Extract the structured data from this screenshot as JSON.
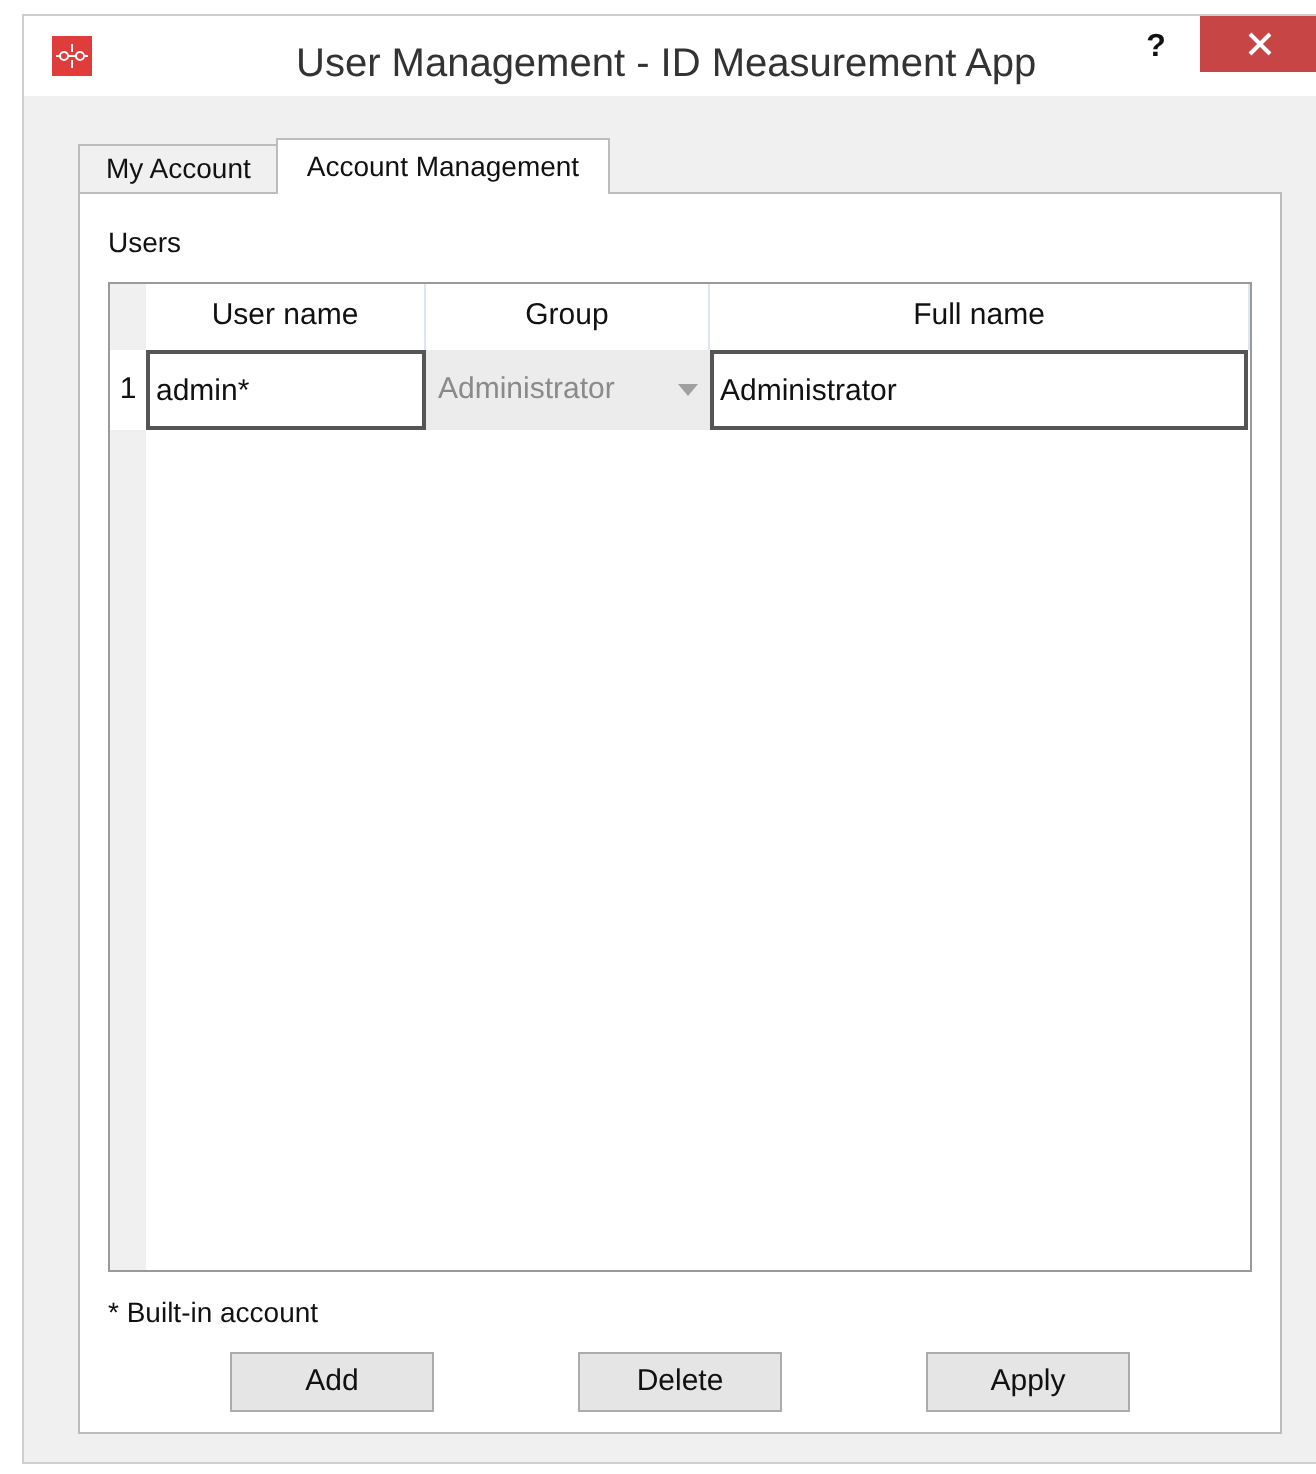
{
  "window": {
    "title": "User Management - ID Measurement App",
    "help": "?"
  },
  "tabs": [
    {
      "label": "My Account",
      "selected": false
    },
    {
      "label": "Account Management",
      "selected": true
    }
  ],
  "users_label": "Users",
  "table": {
    "columns": [
      "User name",
      "Group",
      "Full name"
    ],
    "rows": [
      {
        "number": "1",
        "user_name": "admin*",
        "group": "Administrator",
        "group_disabled": true,
        "full_name": "Administrator"
      }
    ]
  },
  "footnote": "* Built-in account",
  "buttons": [
    "Add",
    "Delete",
    "Apply"
  ]
}
